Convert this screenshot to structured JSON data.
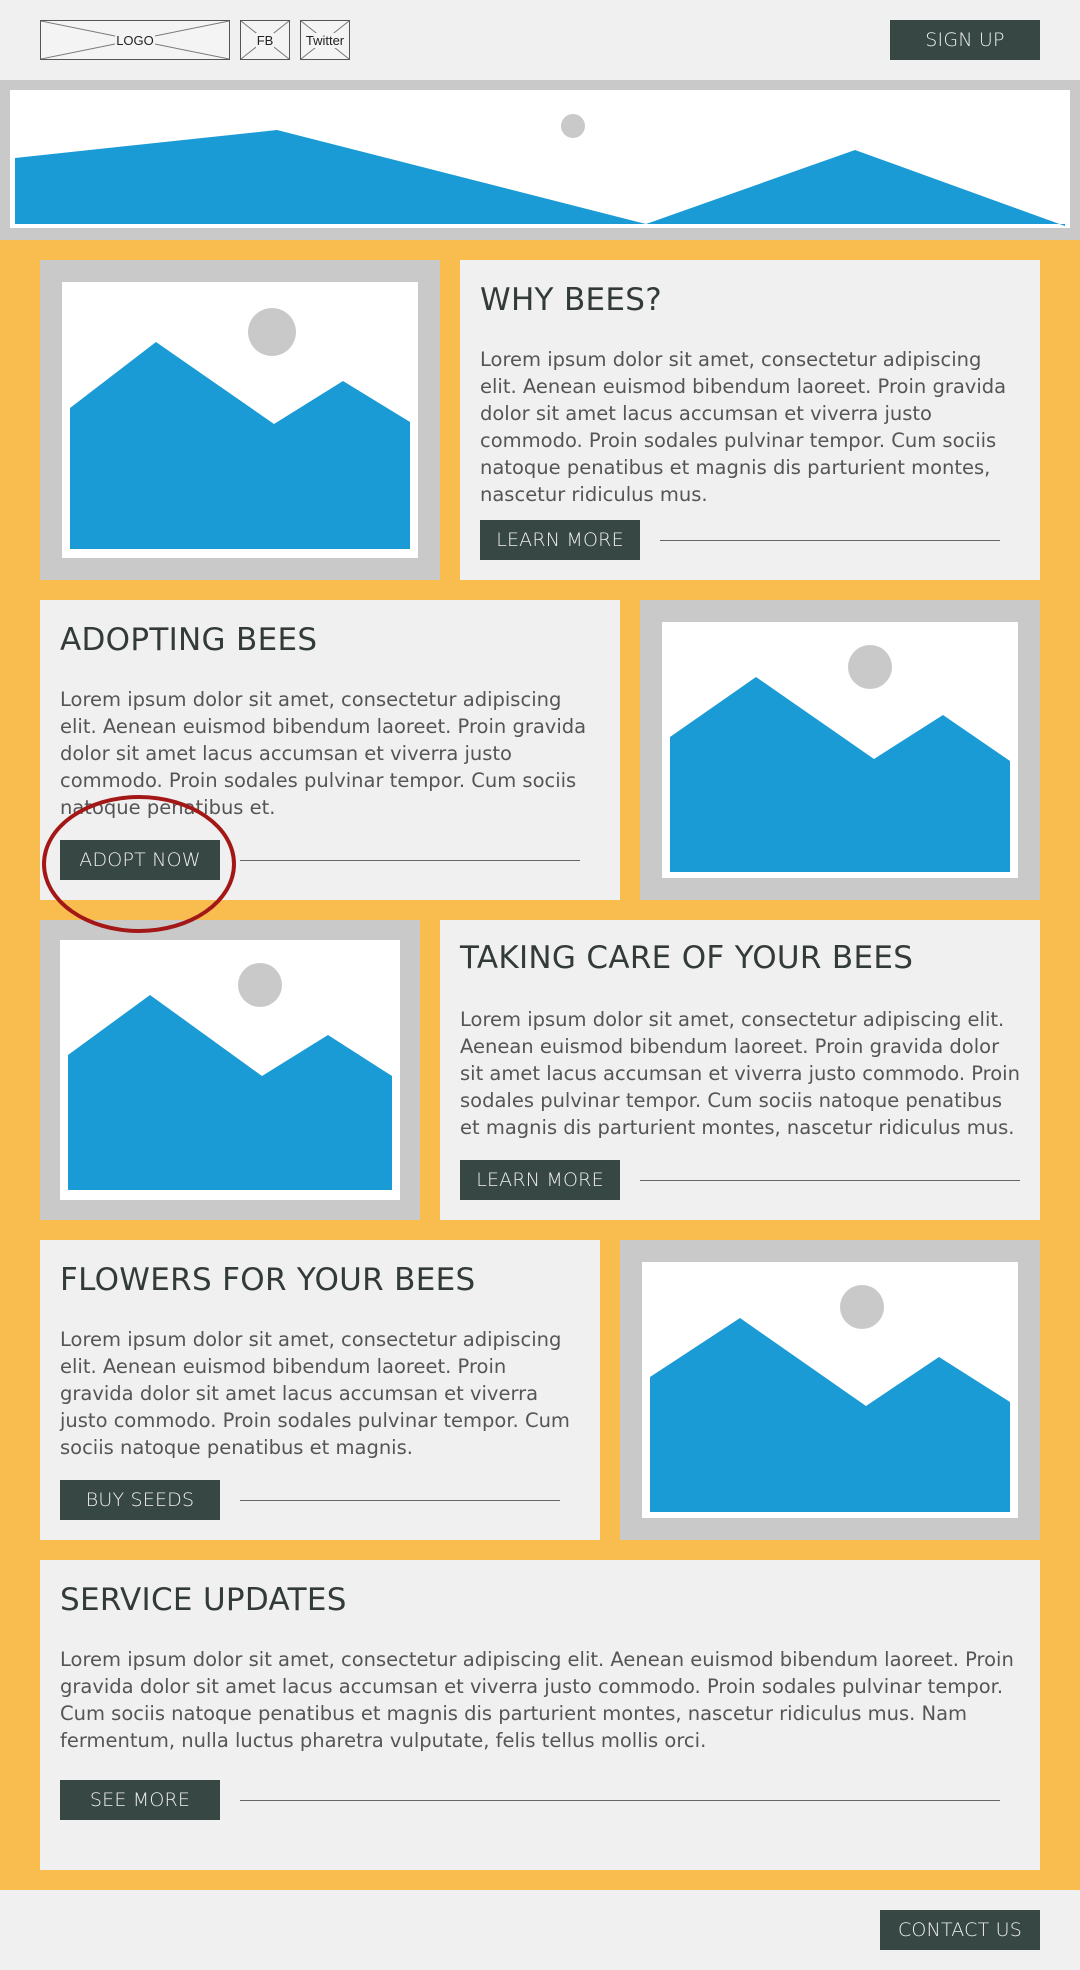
{
  "header": {
    "logo_label": "LOGO",
    "fb_label": "FB",
    "twitter_label": "Twitter",
    "signup_label": "SIGN UP"
  },
  "sections": [
    {
      "title": "WHY BEES?",
      "body": "Lorem ipsum dolor sit amet, consectetur adipiscing elit. Aenean euismod bibendum laoreet. Proin gravida dolor sit amet lacus accumsan et viverra justo commodo. Proin sodales pulvinar tempor. Cum sociis natoque penatibus et magnis dis parturient montes, nascetur ridiculus mus.",
      "button": "LEARN MORE"
    },
    {
      "title": "ADOPTING BEES",
      "body": "Lorem ipsum dolor sit amet, consectetur adipiscing elit. Aenean euismod bibendum laoreet. Proin gravida dolor sit amet lacus accumsan et viverra justo commodo. Proin sodales pulvinar tempor. Cum sociis natoque penatibus et.",
      "button": "ADOPT NOW"
    },
    {
      "title": "TAKING CARE OF YOUR BEES",
      "body": "Lorem ipsum dolor sit amet, consectetur adipiscing elit. Aenean euismod bibendum laoreet. Proin gravida dolor sit amet lacus accumsan et viverra justo commodo. Proin sodales pulvinar tempor. Cum sociis natoque penatibus et magnis dis parturient montes, nascetur ridiculus mus.",
      "button": "LEARN MORE"
    },
    {
      "title": "FLOWERS FOR YOUR BEES",
      "body": "Lorem ipsum dolor sit amet, consectetur adipiscing elit. Aenean euismod bibendum laoreet. Proin gravida dolor sit amet lacus accumsan et viverra justo commodo. Proin sodales pulvinar tempor. Cum sociis natoque penatibus et magnis.",
      "button": "BUY SEEDS"
    },
    {
      "title": "SERVICE UPDATES",
      "body": "Lorem ipsum dolor sit amet, consectetur adipiscing elit. Aenean euismod bibendum laoreet. Proin gravida dolor sit amet lacus accumsan et viverra justo commodo. Proin sodales pulvinar tempor. Cum sociis natoque penatibus et magnis dis parturient montes, nascetur ridiculus mus. Nam fermentum, nulla luctus pharetra vulputate, felis tellus mollis orci.",
      "button": "SEE MORE"
    }
  ],
  "footer": {
    "contact_label": "CONTACT US"
  },
  "colors": {
    "accent_bg": "#f8bd4e",
    "button_bg": "#374744",
    "image_blue": "#1a9bd5",
    "annotation_red": "#a31717"
  }
}
